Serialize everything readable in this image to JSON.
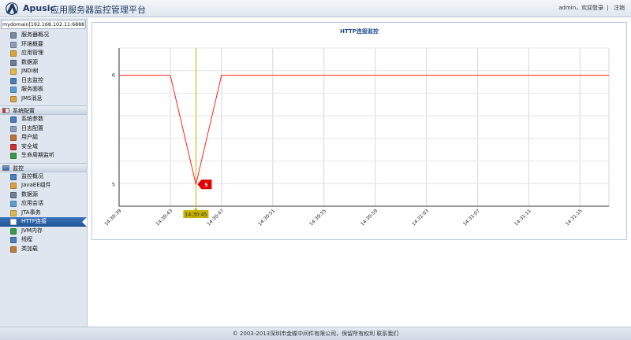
{
  "header": {
    "brand": "Apusic",
    "subtitle": "应用服务器监控管理平台",
    "user": "admin",
    "welcome": "，欢迎登录",
    "separator": "|",
    "logout": "注销"
  },
  "sidebar": {
    "domain": "mydomain[192.168.102.11:6888]",
    "groups": [
      {
        "title": "",
        "items": [
          {
            "label": "服务器概况",
            "icon": "server-icon",
            "color": "#7a8aa3"
          },
          {
            "label": "环境概要",
            "icon": "list-icon",
            "color": "#8ca0b9"
          },
          {
            "label": "应用管理",
            "icon": "app-icon",
            "color": "#d9a441"
          },
          {
            "label": "数据源",
            "icon": "database-icon",
            "color": "#6d7f96"
          },
          {
            "label": "JNDI树",
            "icon": "tree-icon",
            "color": "#e1b64b"
          },
          {
            "label": "日志监控",
            "icon": "monitor-icon",
            "color": "#4b7dbb"
          },
          {
            "label": "服务面板",
            "icon": "panel-icon",
            "color": "#5aa0d3"
          },
          {
            "label": "JMS消息",
            "icon": "message-icon",
            "color": "#d9a441"
          }
        ]
      },
      {
        "title": "系统配置",
        "icon": "config-section-icon",
        "items": [
          {
            "label": "系统参数",
            "icon": "params-icon",
            "color": "#4b7dbb"
          },
          {
            "label": "日志配置",
            "icon": "log-config-icon",
            "color": "#8ca0b9"
          },
          {
            "label": "用户組",
            "icon": "users-icon",
            "color": "#c0703a"
          },
          {
            "label": "安全域",
            "icon": "security-icon",
            "color": "#cc3333"
          },
          {
            "label": "生命周期监听",
            "icon": "lifecycle-icon",
            "color": "#3a9a4a"
          }
        ]
      },
      {
        "title": "监控",
        "icon": "monitor-section-icon",
        "items": [
          {
            "label": "监控概况",
            "icon": "chart-icon",
            "color": "#4b7dbb"
          },
          {
            "label": "JavaEE组件",
            "icon": "component-icon",
            "color": "#d9a441"
          },
          {
            "label": "数据源",
            "icon": "database-icon",
            "color": "#6d7f96"
          },
          {
            "label": "应用会话",
            "icon": "session-icon",
            "color": "#5aa0d3"
          },
          {
            "label": "JTA事务",
            "icon": "transaction-icon",
            "color": "#e1b64b"
          },
          {
            "label": "HTTP连接",
            "icon": "http-icon",
            "color": "#ffffff",
            "active": true
          },
          {
            "label": "JVM内存",
            "icon": "memory-icon",
            "color": "#3a9a4a"
          },
          {
            "label": "线程",
            "icon": "thread-icon",
            "color": "#4b7dbb"
          },
          {
            "label": "类加载",
            "icon": "classload-icon",
            "color": "#c07a3a"
          }
        ]
      }
    ]
  },
  "chart_data": {
    "type": "line",
    "title": "HTTP连接监控",
    "xlabel": "",
    "ylabel": "",
    "ticks": [
      "14:30:39",
      "14:30:43",
      "14:30:47",
      "14:30:51",
      "14:30:55",
      "14:30:59",
      "14:31:03",
      "14:31:07",
      "14:31:11",
      "14:31:15"
    ],
    "y_ticks": [
      6,
      5
    ],
    "ylim": [
      4.8,
      6.25
    ],
    "series": [
      {
        "color": "#ff2222",
        "points": [
          [
            0,
            6
          ],
          [
            1,
            6
          ],
          [
            1.5,
            5
          ],
          [
            2,
            6
          ],
          [
            10,
            6
          ]
        ]
      }
    ],
    "highlight": {
      "x_label": "14:30:45",
      "x_index": 1.5,
      "value": "5",
      "color": "#e00000",
      "marker_color": "#c8b400"
    },
    "grid": true
  },
  "footer": {
    "text": "© 2003-2013深圳市金蝶中间件有限公司，保留所有权利",
    "contact": "联系我们"
  }
}
